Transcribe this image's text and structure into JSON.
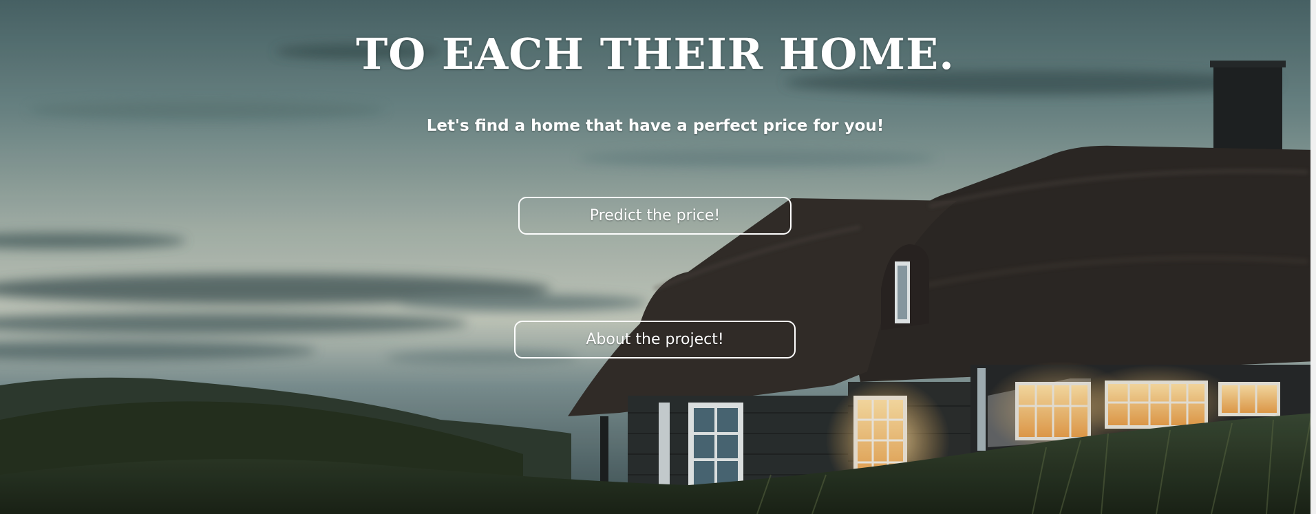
{
  "hero": {
    "title": "TO EACH THEIR HOME.",
    "subtitle": "Let's find a home that have a perfect price for you!",
    "background_image": "thatched-roof-house-at-dusk"
  },
  "buttons": {
    "predict_label": "Predict the price!",
    "about_label": "About the project!"
  },
  "colors": {
    "text": "#ffffff",
    "button_border": "#ffffff",
    "sky_top": "#4f6c6f",
    "sky_mid": "#b9c3b9",
    "roof": "#2a2624",
    "window_light": "#f7c574"
  }
}
